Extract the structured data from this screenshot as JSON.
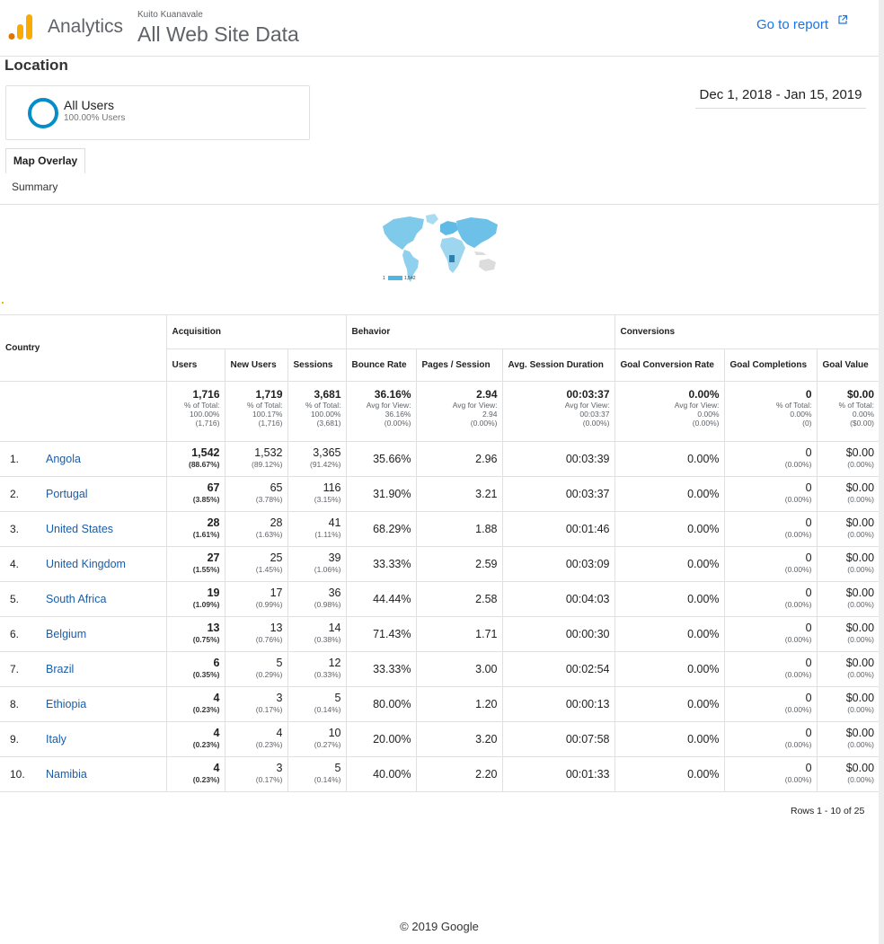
{
  "header": {
    "product": "Analytics",
    "account": "Kuito Kuanavale",
    "property": "All Web Site Data",
    "go_to_report": "Go to report"
  },
  "report": {
    "title": "Location",
    "segment": {
      "name": "All Users",
      "sub": "100.00% Users"
    },
    "date_range": "Dec 1, 2018 - Jan 15, 2019",
    "tabs": [
      "Map Overlay",
      "Summary"
    ],
    "map_legend": {
      "min": "1",
      "max": "1,542"
    }
  },
  "colors": {
    "accent": "#1a73e8",
    "segment_ring": "#058dc7",
    "link": "#1a5da8",
    "map_fill": "#4fb5e4",
    "logo_orange": "#f9ab00",
    "logo_dark_orange": "#e37400"
  },
  "table": {
    "country_header": "Country",
    "groups": [
      "Acquisition",
      "Behavior",
      "Conversions"
    ],
    "columns": [
      "Users",
      "New Users",
      "Sessions",
      "Bounce Rate",
      "Pages / Session",
      "Avg. Session Duration",
      "Goal Conversion Rate",
      "Goal Completions",
      "Goal Value"
    ],
    "totals": [
      {
        "value": "1,716",
        "lines": [
          "% of Total:",
          "100.00%",
          "(1,716)"
        ]
      },
      {
        "value": "1,719",
        "lines": [
          "% of Total:",
          "100.17%",
          "(1,716)"
        ]
      },
      {
        "value": "3,681",
        "lines": [
          "% of Total:",
          "100.00%",
          "(3,681)"
        ]
      },
      {
        "value": "36.16%",
        "lines": [
          "Avg for View:",
          "36.16%",
          "(0.00%)"
        ]
      },
      {
        "value": "2.94",
        "lines": [
          "Avg for View:",
          "2.94",
          "(0.00%)"
        ]
      },
      {
        "value": "00:03:37",
        "lines": [
          "Avg for View:",
          "00:03:37",
          "(0.00%)"
        ]
      },
      {
        "value": "0.00%",
        "lines": [
          "Avg for View:",
          "0.00%",
          "(0.00%)"
        ]
      },
      {
        "value": "0",
        "lines": [
          "% of Total:",
          "0.00%",
          "(0)"
        ]
      },
      {
        "value": "$0.00",
        "lines": [
          "% of Total:",
          "0.00%",
          "($0.00)"
        ]
      }
    ],
    "rows": [
      {
        "idx": "1.",
        "country": "Angola",
        "users": "1,542",
        "users_pct": "(88.67%)",
        "new_users": "1,532",
        "new_users_pct": "(89.12%)",
        "sessions": "3,365",
        "sessions_pct": "(91.42%)",
        "bounce": "35.66%",
        "pps": "2.96",
        "dur": "00:03:39",
        "gcr": "0.00%",
        "gc": "0",
        "gc_pct": "(0.00%)",
        "gv": "$0.00",
        "gv_pct": "(0.00%)"
      },
      {
        "idx": "2.",
        "country": "Portugal",
        "users": "67",
        "users_pct": "(3.85%)",
        "new_users": "65",
        "new_users_pct": "(3.78%)",
        "sessions": "116",
        "sessions_pct": "(3.15%)",
        "bounce": "31.90%",
        "pps": "3.21",
        "dur": "00:03:37",
        "gcr": "0.00%",
        "gc": "0",
        "gc_pct": "(0.00%)",
        "gv": "$0.00",
        "gv_pct": "(0.00%)"
      },
      {
        "idx": "3.",
        "country": "United States",
        "users": "28",
        "users_pct": "(1.61%)",
        "new_users": "28",
        "new_users_pct": "(1.63%)",
        "sessions": "41",
        "sessions_pct": "(1.11%)",
        "bounce": "68.29%",
        "pps": "1.88",
        "dur": "00:01:46",
        "gcr": "0.00%",
        "gc": "0",
        "gc_pct": "(0.00%)",
        "gv": "$0.00",
        "gv_pct": "(0.00%)"
      },
      {
        "idx": "4.",
        "country": "United Kingdom",
        "users": "27",
        "users_pct": "(1.55%)",
        "new_users": "25",
        "new_users_pct": "(1.45%)",
        "sessions": "39",
        "sessions_pct": "(1.06%)",
        "bounce": "33.33%",
        "pps": "2.59",
        "dur": "00:03:09",
        "gcr": "0.00%",
        "gc": "0",
        "gc_pct": "(0.00%)",
        "gv": "$0.00",
        "gv_pct": "(0.00%)"
      },
      {
        "idx": "5.",
        "country": "South Africa",
        "users": "19",
        "users_pct": "(1.09%)",
        "new_users": "17",
        "new_users_pct": "(0.99%)",
        "sessions": "36",
        "sessions_pct": "(0.98%)",
        "bounce": "44.44%",
        "pps": "2.58",
        "dur": "00:04:03",
        "gcr": "0.00%",
        "gc": "0",
        "gc_pct": "(0.00%)",
        "gv": "$0.00",
        "gv_pct": "(0.00%)"
      },
      {
        "idx": "6.",
        "country": "Belgium",
        "users": "13",
        "users_pct": "(0.75%)",
        "new_users": "13",
        "new_users_pct": "(0.76%)",
        "sessions": "14",
        "sessions_pct": "(0.38%)",
        "bounce": "71.43%",
        "pps": "1.71",
        "dur": "00:00:30",
        "gcr": "0.00%",
        "gc": "0",
        "gc_pct": "(0.00%)",
        "gv": "$0.00",
        "gv_pct": "(0.00%)"
      },
      {
        "idx": "7.",
        "country": "Brazil",
        "users": "6",
        "users_pct": "(0.35%)",
        "new_users": "5",
        "new_users_pct": "(0.29%)",
        "sessions": "12",
        "sessions_pct": "(0.33%)",
        "bounce": "33.33%",
        "pps": "3.00",
        "dur": "00:02:54",
        "gcr": "0.00%",
        "gc": "0",
        "gc_pct": "(0.00%)",
        "gv": "$0.00",
        "gv_pct": "(0.00%)"
      },
      {
        "idx": "8.",
        "country": "Ethiopia",
        "users": "4",
        "users_pct": "(0.23%)",
        "new_users": "3",
        "new_users_pct": "(0.17%)",
        "sessions": "5",
        "sessions_pct": "(0.14%)",
        "bounce": "80.00%",
        "pps": "1.20",
        "dur": "00:00:13",
        "gcr": "0.00%",
        "gc": "0",
        "gc_pct": "(0.00%)",
        "gv": "$0.00",
        "gv_pct": "(0.00%)"
      },
      {
        "idx": "9.",
        "country": "Italy",
        "users": "4",
        "users_pct": "(0.23%)",
        "new_users": "4",
        "new_users_pct": "(0.23%)",
        "sessions": "10",
        "sessions_pct": "(0.27%)",
        "bounce": "20.00%",
        "pps": "3.20",
        "dur": "00:07:58",
        "gcr": "0.00%",
        "gc": "0",
        "gc_pct": "(0.00%)",
        "gv": "$0.00",
        "gv_pct": "(0.00%)"
      },
      {
        "idx": "10.",
        "country": "Namibia",
        "users": "4",
        "users_pct": "(0.23%)",
        "new_users": "3",
        "new_users_pct": "(0.17%)",
        "sessions": "5",
        "sessions_pct": "(0.14%)",
        "bounce": "40.00%",
        "pps": "2.20",
        "dur": "00:01:33",
        "gcr": "0.00%",
        "gc": "0",
        "gc_pct": "(0.00%)",
        "gv": "$0.00",
        "gv_pct": "(0.00%)"
      }
    ],
    "rows_info": "Rows 1 - 10 of 25"
  },
  "footer": "© 2019 Google"
}
